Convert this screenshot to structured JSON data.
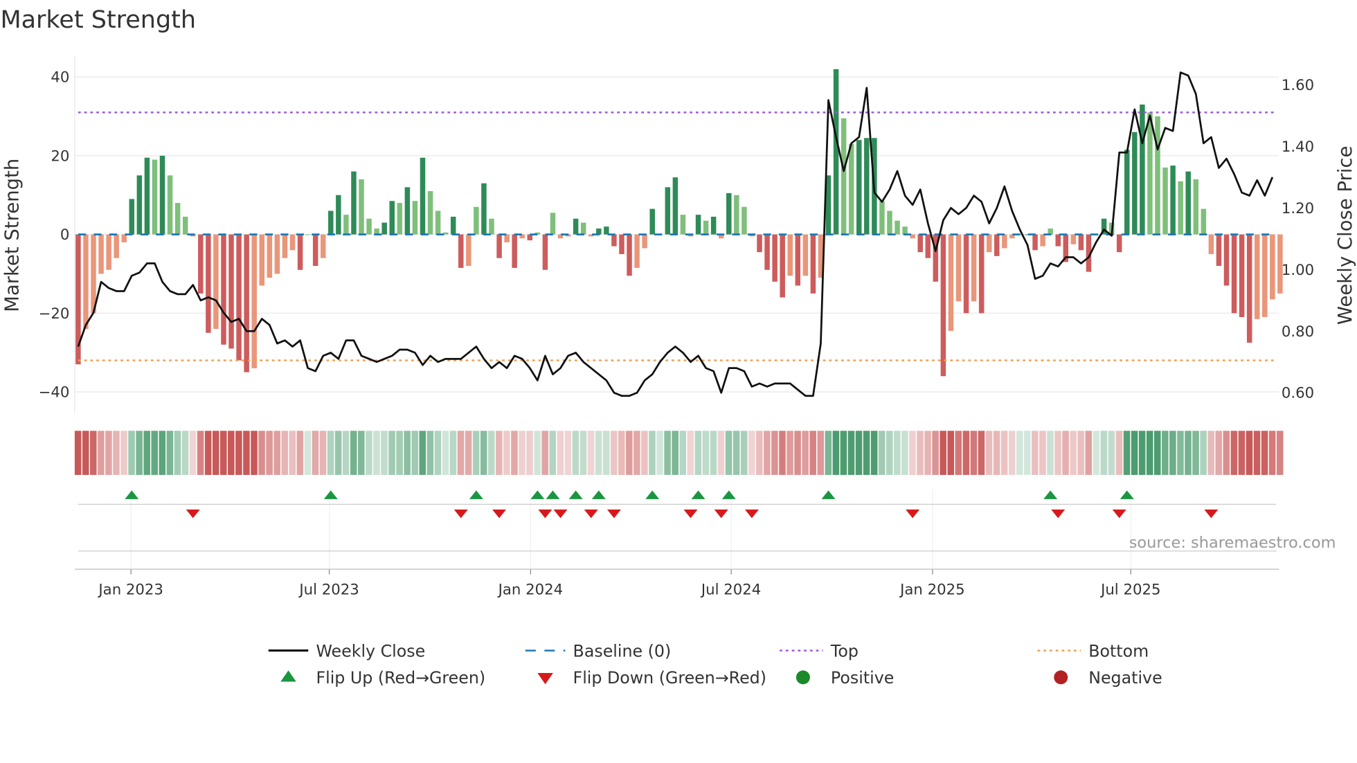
{
  "chart_data": {
    "type": "bar+line",
    "title": "Market Strength",
    "ylabel_left": "Market Strength",
    "ylabel_right": "Weekly Close Price",
    "ylim_left": [
      -45,
      45
    ],
    "ylim_right": [
      0.55,
      1.67
    ],
    "yticks_left": [
      40,
      20,
      0,
      -20,
      -40
    ],
    "yticks_left_labels": [
      "40",
      "20",
      "0",
      "−20",
      "−40"
    ],
    "yticks_right": [
      1.6,
      1.4,
      1.2,
      1.0,
      0.8,
      0.6
    ],
    "yticks_right_labels": [
      "1.60",
      "1.40",
      "1.20",
      "1.00",
      "0.80",
      "0.60"
    ],
    "x_unit": "week index (weekly bars)",
    "xticks": [
      {
        "week": 6.9,
        "label": "Jan 2023"
      },
      {
        "week": 32.8,
        "label": "Jul 2023"
      },
      {
        "week": 59.1,
        "label": "Jan 2024"
      },
      {
        "week": 85.3,
        "label": "Jul 2024"
      },
      {
        "week": 111.6,
        "label": "Jan 2025"
      },
      {
        "week": 137.5,
        "label": "Jul 2025"
      }
    ],
    "top_level": 31,
    "bottom_level": -32,
    "baseline": 0,
    "strength": [
      -33,
      -24,
      -20,
      -10,
      -9,
      -6,
      -2,
      9,
      15,
      19.5,
      19,
      20,
      15,
      8,
      4.5,
      -0.5,
      -15,
      -25,
      -24,
      -28,
      -29,
      -32,
      -35,
      -34,
      -13,
      -11,
      -10,
      -6,
      -4,
      -9,
      0,
      -8,
      -6,
      6,
      10,
      5,
      16,
      14,
      4,
      1.5,
      3,
      8.5,
      8,
      12,
      8.5,
      19.5,
      11,
      6,
      0.5,
      4.5,
      -8.5,
      -8,
      7,
      13,
      4,
      -6,
      -2,
      -8.5,
      -1,
      -1.5,
      0.5,
      -9,
      5.5,
      -1,
      -0.5,
      4,
      3,
      -0.5,
      1.5,
      2,
      -3,
      -5,
      -10.5,
      -8.5,
      -3.5,
      6.5,
      0,
      12,
      14.5,
      5,
      -0.5,
      5,
      3.5,
      4.5,
      -1,
      10.5,
      10,
      7,
      -0.5,
      -4.5,
      -9,
      -12,
      -16,
      -10.5,
      -13,
      -10.5,
      -15,
      -11,
      15,
      42,
      29.5,
      23,
      24,
      24.5,
      24.5,
      8.5,
      6,
      3.5,
      2,
      -1,
      -4.5,
      -6,
      -12,
      -36,
      -24.5,
      -17,
      -20,
      -17,
      -20,
      -4.5,
      -5.5,
      -3.5,
      -1,
      0,
      0,
      -4,
      -3,
      1.5,
      -3,
      -7,
      -2.5,
      -4,
      -9.5,
      0,
      4,
      3,
      -4.5,
      21.5,
      26,
      33,
      31,
      30,
      17,
      17.5,
      13.5,
      16,
      14,
      6.5,
      -5,
      -8,
      -13,
      -20,
      -21,
      -27.5,
      -21.5,
      -21,
      -16.5,
      -15
    ],
    "weekly_close": [
      0.75,
      0.82,
      0.86,
      0.96,
      0.94,
      0.93,
      0.93,
      0.98,
      0.99,
      1.02,
      1.02,
      0.96,
      0.93,
      0.92,
      0.92,
      0.95,
      0.9,
      0.91,
      0.9,
      0.86,
      0.83,
      0.84,
      0.8,
      0.8,
      0.84,
      0.82,
      0.76,
      0.77,
      0.75,
      0.77,
      0.68,
      0.67,
      0.72,
      0.73,
      0.71,
      0.77,
      0.77,
      0.72,
      0.71,
      0.7,
      0.71,
      0.72,
      0.74,
      0.74,
      0.73,
      0.69,
      0.72,
      0.7,
      0.71,
      0.71,
      0.71,
      0.73,
      0.75,
      0.71,
      0.68,
      0.7,
      0.68,
      0.72,
      0.71,
      0.68,
      0.64,
      0.72,
      0.66,
      0.68,
      0.72,
      0.73,
      0.7,
      0.68,
      0.66,
      0.64,
      0.6,
      0.59,
      0.59,
      0.6,
      0.64,
      0.66,
      0.7,
      0.73,
      0.75,
      0.73,
      0.7,
      0.72,
      0.68,
      0.67,
      0.6,
      0.68,
      0.68,
      0.67,
      0.62,
      0.63,
      0.62,
      0.63,
      0.63,
      0.63,
      0.61,
      0.59,
      0.59,
      0.76,
      1.55,
      1.43,
      1.32,
      1.41,
      1.43,
      1.59,
      1.25,
      1.22,
      1.26,
      1.32,
      1.24,
      1.21,
      1.26,
      1.15,
      1.06,
      1.16,
      1.2,
      1.18,
      1.2,
      1.24,
      1.22,
      1.15,
      1.2,
      1.27,
      1.19,
      1.13,
      1.08,
      0.97,
      0.98,
      1.02,
      1.01,
      1.04,
      1.04,
      1.02,
      1.04,
      1.09,
      1.13,
      1.11,
      1.38,
      1.38,
      1.52,
      1.41,
      1.5,
      1.39,
      1.46,
      1.45,
      1.64,
      1.63,
      1.57,
      1.41,
      1.43,
      1.33,
      1.36,
      1.31,
      1.25,
      1.24,
      1.29,
      1.24,
      1.3
    ],
    "legend": [
      {
        "label": "Weekly Close",
        "kind": "line",
        "color": "#111111"
      },
      {
        "label": "Baseline (0)",
        "kind": "dash",
        "color": "#1f77b4"
      },
      {
        "label": "Top",
        "kind": "dot",
        "color": "#9b59d6"
      },
      {
        "label": "Bottom",
        "kind": "dot",
        "color": "#f0a050"
      },
      {
        "label": "Flip Up (Red→Green)",
        "kind": "tri-up",
        "color": "#1a9641"
      },
      {
        "label": "Flip Down (Green→Red)",
        "kind": "tri-down",
        "color": "#d7191c"
      },
      {
        "label": "Positive",
        "kind": "circle",
        "color": "#1a8a2a"
      },
      {
        "label": "Negative",
        "kind": "circle",
        "color": "#b22222"
      }
    ],
    "legend_position": "bottom",
    "grid": true
  },
  "colors": {
    "strong_pos": "#2e8b57",
    "weak_pos": "#7fbf7b",
    "strong_neg": "#cd5c5c",
    "weak_neg": "#e9967a"
  },
  "source": "source: sharemaestro.com"
}
